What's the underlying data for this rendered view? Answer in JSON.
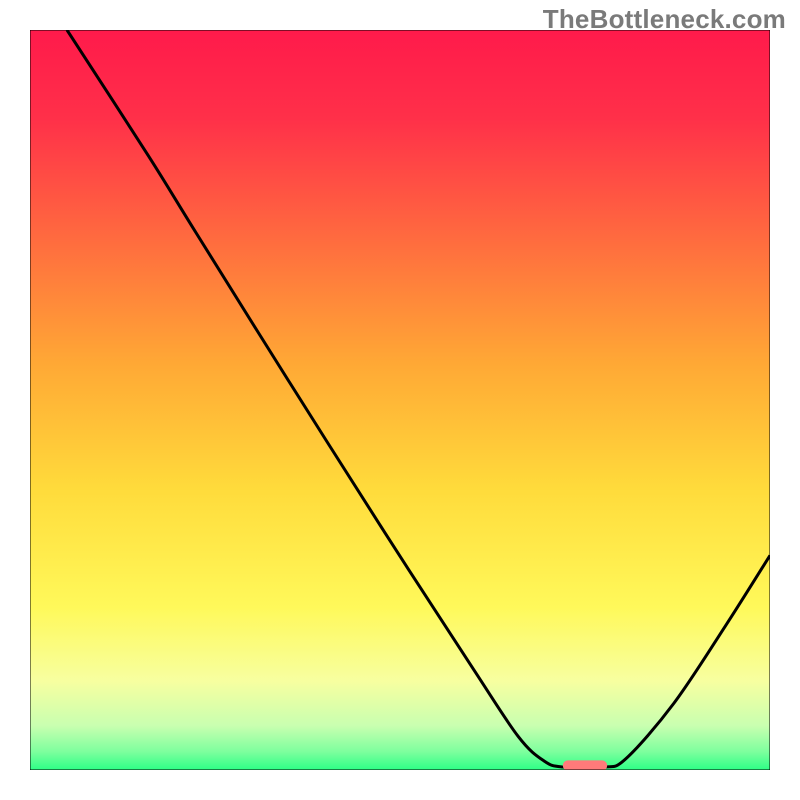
{
  "watermark": "TheBottleneck.com",
  "chart_data": {
    "type": "line",
    "title": "",
    "xlabel": "",
    "ylabel": "",
    "xlim": [
      0,
      100
    ],
    "ylim": [
      0,
      100
    ],
    "axes_visible": false,
    "frame_color": "#000000",
    "background_gradient_stops": [
      {
        "offset": 0.0,
        "color": "#ff1a4b"
      },
      {
        "offset": 0.12,
        "color": "#ff3049"
      },
      {
        "offset": 0.28,
        "color": "#ff6a3f"
      },
      {
        "offset": 0.45,
        "color": "#ffa835"
      },
      {
        "offset": 0.62,
        "color": "#ffdb3b"
      },
      {
        "offset": 0.78,
        "color": "#fff95a"
      },
      {
        "offset": 0.88,
        "color": "#f7ffa0"
      },
      {
        "offset": 0.94,
        "color": "#c9ffb0"
      },
      {
        "offset": 0.975,
        "color": "#7eff9e"
      },
      {
        "offset": 1.0,
        "color": "#2dff86"
      }
    ],
    "series": [
      {
        "name": "bottleneck-curve",
        "stroke": "#000000",
        "stroke_width": 3,
        "points_xy": [
          [
            5.0,
            100.0
          ],
          [
            16.0,
            83.0
          ],
          [
            22.5,
            72.5
          ],
          [
            35.0,
            52.5
          ],
          [
            48.0,
            32.0
          ],
          [
            60.0,
            13.5
          ],
          [
            66.0,
            4.5
          ],
          [
            69.5,
            1.2
          ],
          [
            72.0,
            0.4
          ],
          [
            77.5,
            0.4
          ],
          [
            80.5,
            1.5
          ],
          [
            87.0,
            9.0
          ],
          [
            94.0,
            19.5
          ],
          [
            100.0,
            29.0
          ]
        ]
      }
    ],
    "marker": {
      "name": "optimal-segment",
      "x_start": 72.0,
      "x_end": 78.0,
      "y": 0.6,
      "color": "#ff7a7a",
      "thickness_pct": 1.4
    }
  }
}
